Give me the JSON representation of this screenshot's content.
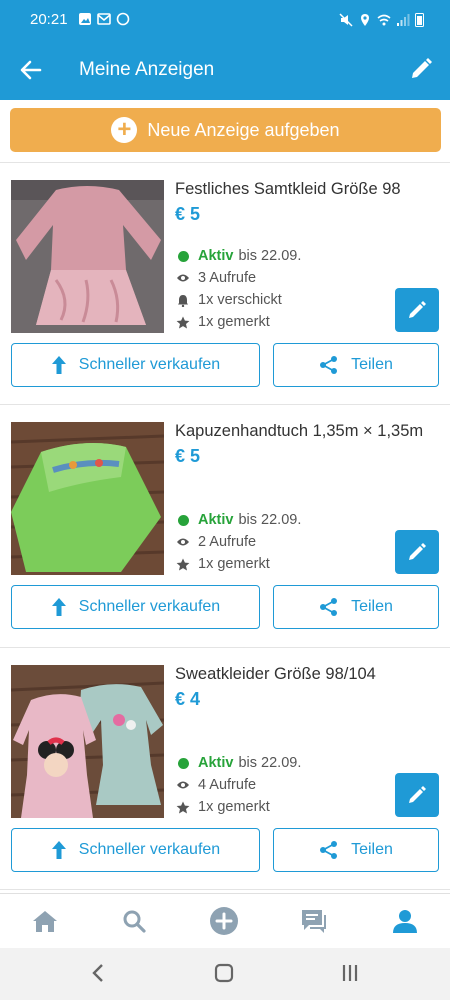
{
  "status": {
    "time": "20:21"
  },
  "header": {
    "title": "Meine Anzeigen"
  },
  "new_ad": {
    "label": "Neue Anzeige aufgeben"
  },
  "ads": [
    {
      "title": "Festliches Samtkleid Größe 98",
      "price": "€ 5",
      "status": "Aktiv",
      "until": "bis 22.09.",
      "views": "3 Aufrufe",
      "sent": "1x verschickt",
      "saved": "1x gemerkt",
      "sell_label": "Schneller verkaufen",
      "share_label": "Teilen"
    },
    {
      "title": "Kapuzenhandtuch 1,35m × 1,35m",
      "price": "€ 5",
      "status": "Aktiv",
      "until": "bis 22.09.",
      "views": "2 Aufrufe",
      "saved": "1x gemerkt",
      "sell_label": "Schneller verkaufen",
      "share_label": "Teilen"
    },
    {
      "title": "Sweatkleider Größe 98/104",
      "price": "€ 4",
      "status": "Aktiv",
      "until": "bis 22.09.",
      "views": "4 Aufrufe",
      "saved": "1x gemerkt",
      "sell_label": "Schneller verkaufen",
      "share_label": "Teilen"
    }
  ],
  "bottom_nav": [
    "home-icon",
    "search-icon",
    "add-icon",
    "messages-icon",
    "profile-icon"
  ],
  "colors": {
    "primary": "#1f9ad6",
    "accent": "#f0ad4e",
    "active": "#27a33a"
  }
}
